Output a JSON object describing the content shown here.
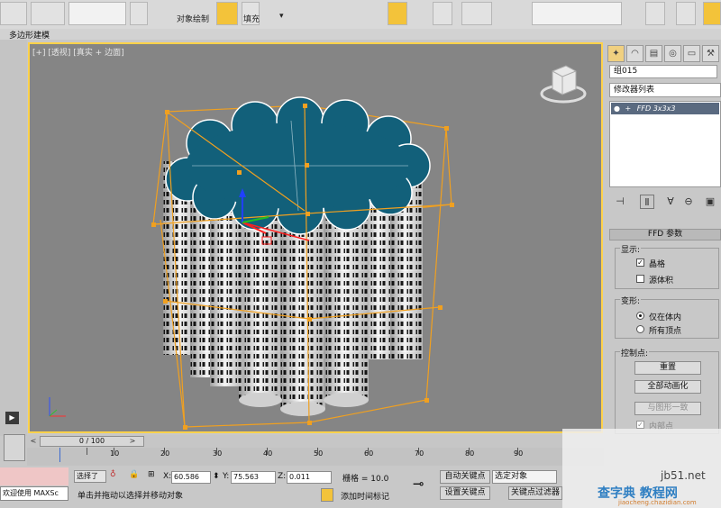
{
  "toolbar": {
    "menu_item_1": "对象绘制",
    "menu_item_2": "填充"
  },
  "ribbon": {
    "tab_label": "多边形建模"
  },
  "viewport": {
    "label": "[+] [透视] [真实 + 边面]",
    "model_top_color": "#12607a",
    "lattice_color": "#f0a020",
    "frame_color": "#ffd24a"
  },
  "command_panel": {
    "tabs": [
      "create-icon",
      "modify-icon",
      "hierarchy-icon",
      "motion-icon",
      "display-icon",
      "utilities-icon"
    ],
    "object_name": "组015",
    "modifier_list": "修改器列表",
    "stack_item": "FFD 3x3x3",
    "rollout_title": "FFD 参数",
    "display_group": {
      "label": "显示:",
      "lattice": {
        "label": "晶格",
        "checked": true
      },
      "source_volume": {
        "label": "源体积",
        "checked": false
      }
    },
    "deform_group": {
      "label": "变形:",
      "only_in_volume": {
        "label": "仅在体内",
        "selected": true
      },
      "all_vertices": {
        "label": "所有顶点",
        "selected": false
      }
    },
    "control_points_group": {
      "label": "控制点:",
      "reset_button": "重置",
      "animate_all_button": "全部动画化",
      "conform_button": "与图形一致",
      "inside_points": "内部点"
    }
  },
  "timeline": {
    "frame_display": "0 / 100",
    "prev_arrow": "<",
    "next_arrow": ">",
    "ticks": [
      "0",
      "10",
      "20",
      "30",
      "40",
      "50",
      "60",
      "70",
      "80",
      "90"
    ]
  },
  "status": {
    "welcome": "欢迎使用 MAXSc",
    "selection_label": "选择了",
    "x_label": "X:",
    "x_value": "60.586",
    "y_label": "Y:",
    "y_value": "75.563",
    "z_label": "Z:",
    "z_value": "0.011",
    "grid_label": "栅格 = 10.0",
    "auto_key_button": "自动关键点",
    "set_key_button": "设置关键点",
    "selected_dropdown": "选定对象",
    "key_filters_button": "关键点过滤器",
    "add_time_tag": "添加时间标记",
    "prompt": "单击并拖动以选择并移动对象"
  },
  "watermark": {
    "line1": "jb51.net",
    "line2": "查字典 教程网",
    "line3": "jiaocheng.chazidian.com"
  }
}
